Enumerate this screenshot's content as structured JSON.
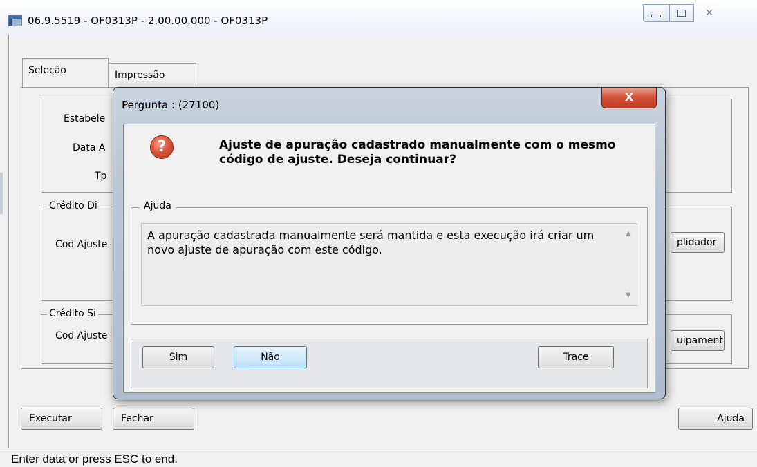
{
  "window": {
    "title": "06.9.5519 - OF0313P - 2.00.00.000 - OF0313P",
    "controls": [
      "minimize",
      "maximize",
      "close"
    ]
  },
  "tabs": [
    {
      "label": "Seleção",
      "selected": true
    },
    {
      "label": "Impressão",
      "selected": false
    }
  ],
  "form": {
    "labels": {
      "estabelecimento": "Estabele",
      "data": "Data A",
      "tp": "Tp"
    },
    "credito_di": {
      "legend": "Crédito Di",
      "cod_ajuste": "Cod Ajuste",
      "button": "plidador"
    },
    "credito_si": {
      "legend": "Crédito Si",
      "cod_ajuste": "Cod Ajuste",
      "button": "uipamenti"
    }
  },
  "footer": {
    "executar": "Executar",
    "fechar": "Fechar",
    "ajuda": "Ajuda"
  },
  "status": "Enter data or press ESC to end.",
  "dialog": {
    "title": "Pergunta : (27100)",
    "close_glyph": "X",
    "icon": "question-icon",
    "icon_glyph": "?",
    "question": "Ajuste de apuração cadastrado manualmente com o mesmo código de ajuste. Deseja continuar?",
    "help_legend": "Ajuda",
    "help_text": "A apuração cadastrada manualmente será mantida e esta execução irá criar um novo ajuste de apuração com este código.",
    "buttons": {
      "sim": "Sim",
      "nao": "Não",
      "trace": "Trace"
    }
  },
  "colors": {
    "window_bg": "#f0f0f0",
    "dialog_frame": "#b7c4d3",
    "close_red": "#c03a21",
    "focused_button": "#bfe1f7"
  }
}
